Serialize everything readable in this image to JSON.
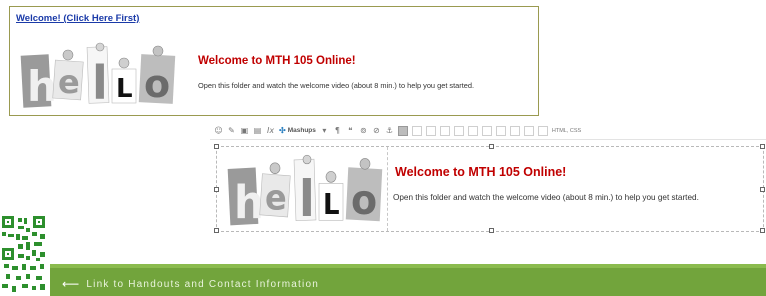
{
  "preview_card": {
    "link_text": "Welcome! (Click Here First)",
    "title": "Welcome to MTH 105 Online!",
    "description": "Open this folder and watch the welcome video (about 8 min.) to help you get started."
  },
  "hello_image": {
    "letters": [
      "h",
      "e",
      "l",
      "L",
      "o"
    ]
  },
  "editor": {
    "toolbar": {
      "buttons": [
        "smiley-icon",
        "format-painter-icon",
        "image-icon",
        "media-icon",
        "clear-format-icon"
      ],
      "mashups_label": "Mashups",
      "mashups_caret": "▾",
      "html_css_label": "HTML, CSS"
    },
    "title": "Welcome to MTH 105 Online!",
    "description": "Open this folder and watch the welcome video (about 8 min.) to help you get started."
  },
  "footer_bar": {
    "link_text": "Link to Handouts and Contact Information",
    "arrow": "⟵",
    "color": "#72a43c"
  }
}
